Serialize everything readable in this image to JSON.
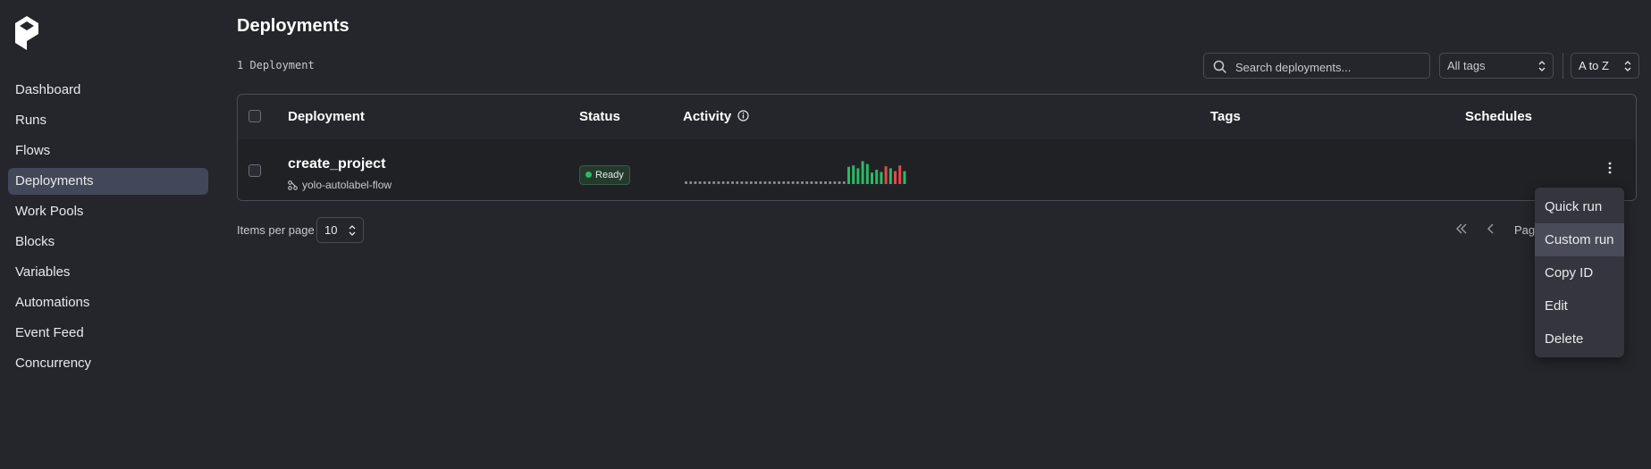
{
  "sidebar": {
    "logo_icon": "prefect-logo-icon",
    "items": [
      {
        "label": "Dashboard"
      },
      {
        "label": "Runs"
      },
      {
        "label": "Flows"
      },
      {
        "label": "Deployments",
        "active": true
      },
      {
        "label": "Work Pools"
      },
      {
        "label": "Blocks"
      },
      {
        "label": "Variables"
      },
      {
        "label": "Automations"
      },
      {
        "label": "Event Feed"
      },
      {
        "label": "Concurrency"
      }
    ]
  },
  "header": {
    "title": "Deployments",
    "count_text": "1 Deployment"
  },
  "toolbar": {
    "search_placeholder": "Search deployments...",
    "tags_filter": "All tags",
    "sort": "A to Z"
  },
  "table": {
    "columns": [
      "Deployment",
      "Status",
      "Activity",
      "Tags",
      "Schedules"
    ],
    "rows": [
      {
        "name": "create_project",
        "flow": "yolo-autolabel-flow",
        "status": "Ready",
        "tags": "",
        "schedules": "",
        "activity": {
          "empty_slots": 35,
          "bars": [
            {
              "h": 0.6,
              "state": "completed"
            },
            {
              "h": 0.65,
              "state": "completed"
            },
            {
              "h": 0.55,
              "state": "completed"
            },
            {
              "h": 0.8,
              "state": "completed"
            },
            {
              "h": 0.7,
              "state": "completed"
            },
            {
              "h": 0.4,
              "state": "completed"
            },
            {
              "h": 0.5,
              "state": "completed"
            },
            {
              "h": 0.42,
              "state": "completed"
            },
            {
              "h": 0.62,
              "state": "failed"
            },
            {
              "h": 0.55,
              "state": "completed"
            },
            {
              "h": 0.45,
              "state": "failed"
            },
            {
              "h": 0.65,
              "state": "failed"
            },
            {
              "h": 0.45,
              "state": "completed"
            }
          ]
        }
      }
    ]
  },
  "pagination": {
    "items_per_page_label": "Items per page",
    "items_per_page": "10",
    "page_text": "Pag"
  },
  "context_menu": {
    "items": [
      {
        "label": "Quick run"
      },
      {
        "label": "Custom run",
        "hover": true
      },
      {
        "label": "Copy ID"
      },
      {
        "label": "Edit"
      },
      {
        "label": "Delete"
      }
    ]
  },
  "colors": {
    "background": "#25262b",
    "active_nav": "#43475a",
    "completed": "#2fb865",
    "failed": "#e5484d",
    "ready_dot": "#2fb865"
  }
}
